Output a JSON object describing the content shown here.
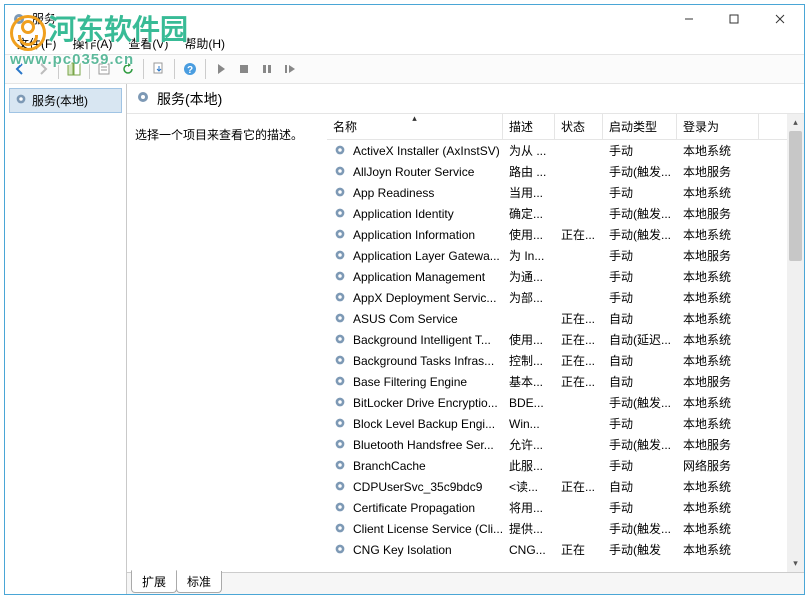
{
  "watermark": {
    "text": "河东软件园",
    "sub": "www.pc0359.cn"
  },
  "window": {
    "title": "服务"
  },
  "menu": {
    "file": "文件(F)",
    "action": "操作(A)",
    "view": "查看(V)",
    "help": "帮助(H)"
  },
  "nav": {
    "root": "服务(本地)"
  },
  "detail": {
    "heading": "服务(本地)",
    "prompt": "选择一个项目来查看它的描述。"
  },
  "columns": {
    "name": "名称",
    "desc": "描述",
    "status": "状态",
    "startup": "启动类型",
    "logon": "登录为"
  },
  "tabs": {
    "ext": "扩展",
    "std": "标准"
  },
  "services": [
    {
      "name": "ActiveX Installer (AxInstSV)",
      "desc": "为从 ...",
      "status": "",
      "startup": "手动",
      "logon": "本地系统"
    },
    {
      "name": "AllJoyn Router Service",
      "desc": "路由 ...",
      "status": "",
      "startup": "手动(触发...",
      "logon": "本地服务"
    },
    {
      "name": "App Readiness",
      "desc": "当用...",
      "status": "",
      "startup": "手动",
      "logon": "本地系统"
    },
    {
      "name": "Application Identity",
      "desc": "确定...",
      "status": "",
      "startup": "手动(触发...",
      "logon": "本地服务"
    },
    {
      "name": "Application Information",
      "desc": "使用...",
      "status": "正在...",
      "startup": "手动(触发...",
      "logon": "本地系统"
    },
    {
      "name": "Application Layer Gatewa...",
      "desc": "为 In...",
      "status": "",
      "startup": "手动",
      "logon": "本地服务"
    },
    {
      "name": "Application Management",
      "desc": "为通...",
      "status": "",
      "startup": "手动",
      "logon": "本地系统"
    },
    {
      "name": "AppX Deployment Servic...",
      "desc": "为部...",
      "status": "",
      "startup": "手动",
      "logon": "本地系统"
    },
    {
      "name": "ASUS Com Service",
      "desc": "",
      "status": "正在...",
      "startup": "自动",
      "logon": "本地系统"
    },
    {
      "name": "Background Intelligent T...",
      "desc": "使用...",
      "status": "正在...",
      "startup": "自动(延迟...",
      "logon": "本地系统"
    },
    {
      "name": "Background Tasks Infras...",
      "desc": "控制...",
      "status": "正在...",
      "startup": "自动",
      "logon": "本地系统"
    },
    {
      "name": "Base Filtering Engine",
      "desc": "基本...",
      "status": "正在...",
      "startup": "自动",
      "logon": "本地服务"
    },
    {
      "name": "BitLocker Drive Encryptio...",
      "desc": "BDE...",
      "status": "",
      "startup": "手动(触发...",
      "logon": "本地系统"
    },
    {
      "name": "Block Level Backup Engi...",
      "desc": "Win...",
      "status": "",
      "startup": "手动",
      "logon": "本地系统"
    },
    {
      "name": "Bluetooth Handsfree Ser...",
      "desc": "允许...",
      "status": "",
      "startup": "手动(触发...",
      "logon": "本地服务"
    },
    {
      "name": "BranchCache",
      "desc": "此服...",
      "status": "",
      "startup": "手动",
      "logon": "网络服务"
    },
    {
      "name": "CDPUserSvc_35c9bdc9",
      "desc": "<读...",
      "status": "正在...",
      "startup": "自动",
      "logon": "本地系统"
    },
    {
      "name": "Certificate Propagation",
      "desc": "将用...",
      "status": "",
      "startup": "手动",
      "logon": "本地系统"
    },
    {
      "name": "Client License Service (Cli...",
      "desc": "提供...",
      "status": "",
      "startup": "手动(触发...",
      "logon": "本地系统"
    },
    {
      "name": "CNG Key Isolation",
      "desc": "CNG...",
      "status": "正在",
      "startup": "手动(触发",
      "logon": "本地系统"
    }
  ]
}
